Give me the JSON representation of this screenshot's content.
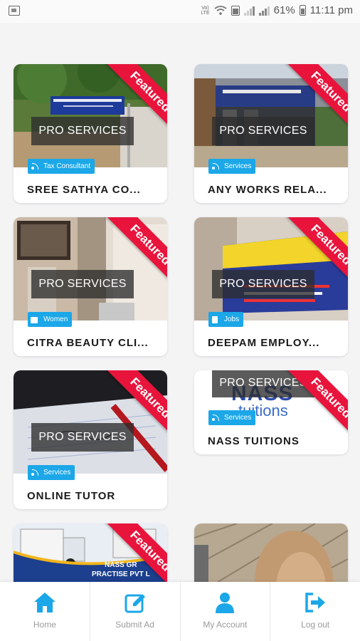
{
  "status_bar": {
    "network": "Vo) LTE",
    "battery": "61%",
    "time": "11:11 pm"
  },
  "colors": {
    "accent": "#1ba7e8",
    "ribbon": "#e8143c",
    "nav_icon": "#1ba7e8"
  },
  "listings": [
    {
      "title": "SREE SATHYA CO...",
      "category": "Tax Consultant",
      "category_icon": "rss-icon",
      "badge": "PRO SERVICES",
      "ribbon": "Featured"
    },
    {
      "title": "ANY WORKS RELA...",
      "category": "Services",
      "category_icon": "rss-icon",
      "badge": "PRO SERVICES",
      "ribbon": "Featured"
    },
    {
      "title": "CITRA BEAUTY CLI...",
      "category": "Women",
      "category_icon": "shirt-icon",
      "badge": "PRO SERVICES",
      "ribbon": "Featured"
    },
    {
      "title": "DEEPAM EMPLOY...",
      "category": "Jobs",
      "category_icon": "id-badge-icon",
      "badge": "PRO SERVICES",
      "ribbon": "Featured"
    },
    {
      "title": "ONLINE TUTOR",
      "category": "Services",
      "category_icon": "rss-icon",
      "badge": "PRO SERVICES",
      "ribbon": "Featured"
    },
    {
      "title": "NASS TUITIONS",
      "category": "Services",
      "category_icon": "rss-icon",
      "badge": "PRO SERVICES",
      "ribbon": "Featured",
      "logo": {
        "line1": "NASS",
        "line2": "tuitions"
      }
    },
    {
      "title": "",
      "category": "",
      "badge": "",
      "ribbon": "Featured",
      "image_text": [
        "NASS GR",
        "PRACTISE PVT L"
      ]
    },
    {
      "title": "",
      "category": "",
      "badge": "",
      "ribbon": ""
    }
  ],
  "bottom_nav": [
    {
      "label": "Home",
      "icon": "home-icon"
    },
    {
      "label": "Submit Ad",
      "icon": "edit-icon"
    },
    {
      "label": "My Account",
      "icon": "user-icon"
    },
    {
      "label": "Log out",
      "icon": "logout-icon"
    }
  ]
}
